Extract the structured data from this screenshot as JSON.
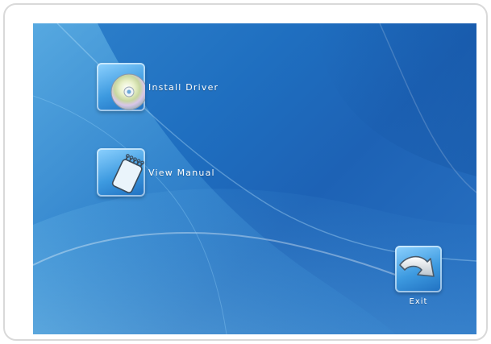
{
  "menu": {
    "install_driver": {
      "label": "Install Driver",
      "icon": "cd-disc-icon"
    },
    "view_manual": {
      "label": "View Manual",
      "icon": "notepad-icon"
    },
    "exit": {
      "label": "Exit",
      "icon": "curved-arrow-icon"
    }
  },
  "colors": {
    "panel_blue": "#1f6fc0",
    "panel_light": "#6cc4f0",
    "tile_light": "#8ed2ff",
    "frame_border": "#d9d9d9"
  }
}
